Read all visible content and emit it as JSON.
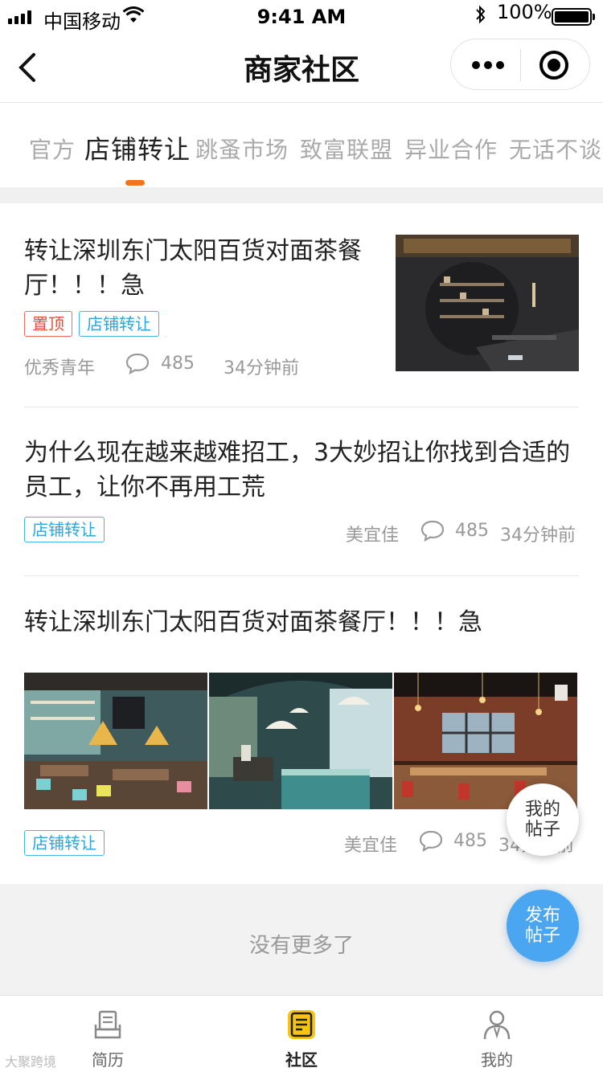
{
  "status_bar": {
    "carrier": "中国移动",
    "time": "9:41 AM",
    "battery_percent": "100%"
  },
  "nav": {
    "title": "商家社区"
  },
  "tabs": [
    {
      "label": "官方",
      "active": false
    },
    {
      "label": "店铺转让",
      "active": true
    },
    {
      "label": "跳蚤市场",
      "active": false
    },
    {
      "label": "致富联盟",
      "active": false
    },
    {
      "label": "异业合作",
      "active": false
    },
    {
      "label": "无话不谈",
      "active": false
    }
  ],
  "posts": [
    {
      "title": "转让深圳东门太阳百货对面茶餐厅！！！急",
      "tags": [
        "置顶",
        "店铺转让"
      ],
      "author": "优秀青年",
      "comments": "485",
      "time": "34分钟前"
    },
    {
      "title": "为什么现在越来越难招工，3大妙招让你找到合适的员工，让你不再用工荒",
      "tags": [
        "店铺转让"
      ],
      "author": "美宜佳",
      "comments": "485",
      "time": "34分钟前"
    },
    {
      "title": "转让深圳东门太阳百货对面茶餐厅！！！急",
      "tags": [
        "店铺转让"
      ],
      "author": "美宜佳",
      "comments": "485",
      "time": "34分钟前"
    }
  ],
  "floating": {
    "my_posts": "我的帖子",
    "publish": "发布帖子"
  },
  "end_text": "没有更多了",
  "tabbar": [
    {
      "label": "简历",
      "icon": "resume-icon",
      "active": false
    },
    {
      "label": "社区",
      "icon": "community-icon",
      "active": true
    },
    {
      "label": "我的",
      "icon": "profile-icon",
      "active": false
    }
  ],
  "watermark": "大聚跨境",
  "colors": {
    "accent_orange": "#f5731a",
    "tag_blue": "#2aa5df",
    "tag_red": "#e84e3c",
    "fab_blue": "#4aa6f0",
    "community_yellow": "#f7c315"
  }
}
